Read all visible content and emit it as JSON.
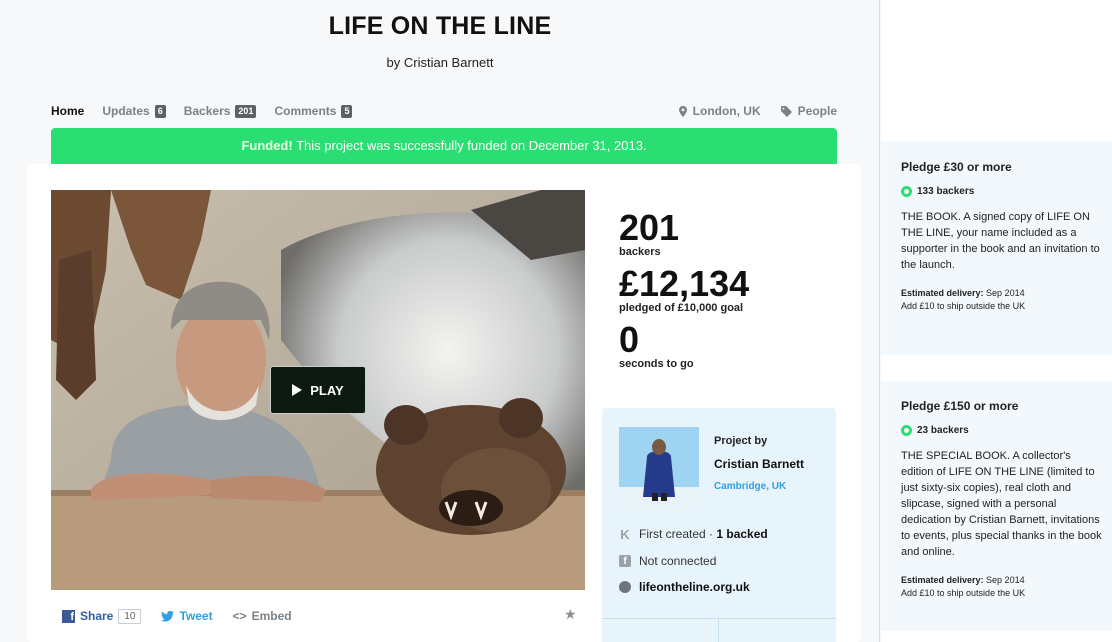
{
  "project": {
    "title": "LIFE ON THE LINE",
    "byline": "by Cristian Barnett"
  },
  "nav": {
    "home": "Home",
    "updates": "Updates",
    "updates_count": "6",
    "backers": "Backers",
    "backers_count": "201",
    "comments": "Comments",
    "comments_count": "5",
    "location": "London, UK",
    "category": "People"
  },
  "banner": {
    "funded_label": "Funded!",
    "funded_text": " This project was successfully funded on December 31, 2013.",
    "color": "#2bde73"
  },
  "video": {
    "play_label": "PLAY"
  },
  "share": {
    "facebook_label": "Share",
    "facebook_count": "10",
    "tweet_label": "Tweet",
    "embed_label": "Embed"
  },
  "stats": {
    "backers_value": "201",
    "backers_label": "backers",
    "pledged_value": "£12,134",
    "pledged_label": "pledged of £10,000 goal",
    "time_value": "0",
    "time_label": "seconds to go"
  },
  "creator": {
    "by_label": "Project by",
    "name": "Cristian Barnett",
    "location": "Cambridge, UK",
    "first_created": "First created · ",
    "backed": "1 backed",
    "facebook": "Not connected",
    "website": "lifeontheline.org.uk"
  },
  "rewards": [
    {
      "heading": "Pledge £30 or more",
      "backers": "133 backers",
      "description": "THE BOOK. A signed copy of LIFE ON THE LINE, your name included as a supporter in the book and an invitation to the launch.",
      "delivery_label": "Estimated delivery:",
      "delivery_date": " Sep 2014",
      "shipping": "Add £10 to ship outside the UK"
    },
    {
      "heading": "Pledge £150 or more",
      "backers": "23 backers",
      "description": "THE SPECIAL BOOK. A collector's edition of LIFE ON THE LINE (limited to just sixty-six copies), real cloth and slipcase, signed with a personal dedication by Cristian Barnett, invitations to events, plus special thanks in the book and online.",
      "delivery_label": "Estimated delivery:",
      "delivery_date": " Sep 2014",
      "shipping": "Add £10 to ship outside the UK"
    }
  ]
}
